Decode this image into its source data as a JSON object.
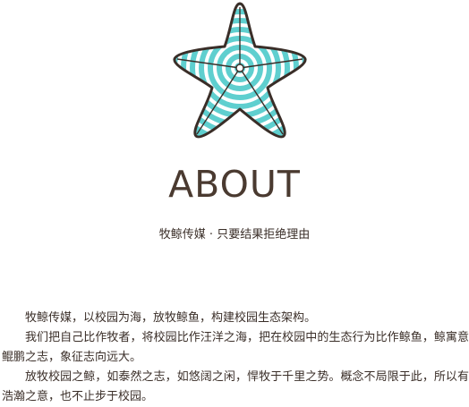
{
  "colors": {
    "starfish_fill": "#5fcfcf",
    "starfish_outline": "#3a2e28",
    "starfish_stripe": "#ffffff"
  },
  "logo": {
    "icon": "starfish-icon"
  },
  "header": {
    "title": "ABOUT",
    "tagline": "牧鲸传媒 · 只要结果拒绝理由"
  },
  "about": {
    "paragraphs": [
      "牧鲸传媒，以校园为海，放牧鲸鱼，构建校园生态架构。",
      "我们把自己比作牧者，将校园比作汪洋之海，把在校园中的生态行为比作鲸鱼，鲸寓意鲲鹏之志，象征志向远大。",
      "放牧校园之鲸，如泰然之志，如悠阔之闲，悍牧于千里之势。概念不局限于此，所以有浩瀚之意，也不止步于校园。"
    ]
  }
}
